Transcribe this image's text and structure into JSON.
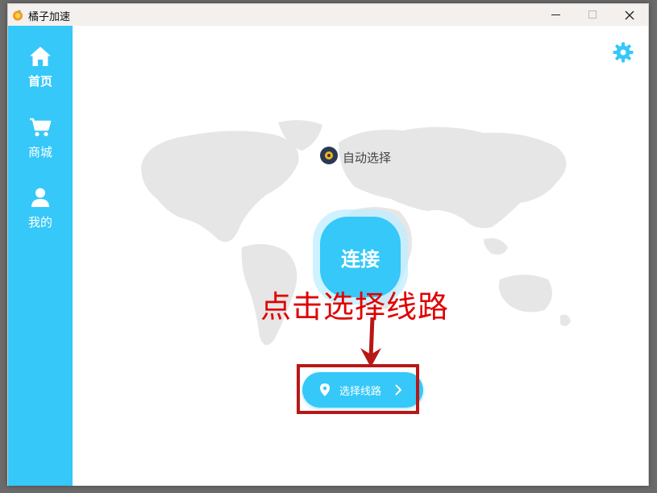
{
  "window": {
    "title": "橘子加速"
  },
  "sidebar": {
    "items": [
      {
        "label": "首页",
        "icon": "home-icon",
        "active": true
      },
      {
        "label": "商城",
        "icon": "cart-icon",
        "active": false
      },
      {
        "label": "我的",
        "icon": "user-icon",
        "active": false
      }
    ]
  },
  "main": {
    "auto_select_label": "自动选择",
    "connect_label": "连接",
    "route_button_label": "选择线路"
  },
  "annotation": {
    "text": "点击选择线路"
  },
  "colors": {
    "accent": "#35c8f8",
    "annotation": "#e00000",
    "map": "#e6e6e6"
  }
}
